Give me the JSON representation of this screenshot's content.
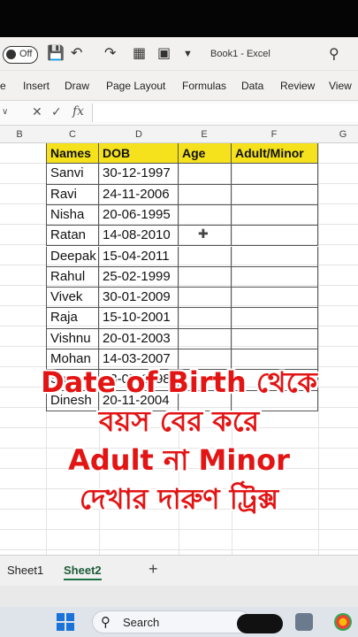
{
  "titlebar": {
    "autosave_label": "Off",
    "doc_title": "Book1  -  Excel"
  },
  "ribbon": {
    "tabs": [
      "e",
      "Insert",
      "Draw",
      "Page Layout",
      "Formulas",
      "Data",
      "Review",
      "View"
    ]
  },
  "formula": {
    "fx_label": "fx"
  },
  "columns": [
    "B",
    "C",
    "D",
    "E",
    "F",
    "G"
  ],
  "table": {
    "headers": [
      "Names",
      "DOB",
      "Age",
      "Adult/Minor"
    ],
    "rows": [
      [
        "Sanvi",
        "30-12-1997"
      ],
      [
        "Ravi",
        "24-11-2006"
      ],
      [
        "Nisha",
        "20-06-1995"
      ],
      [
        "Ratan",
        "14-08-2010"
      ],
      [
        "Deepak",
        "15-04-2011"
      ],
      [
        "Rahul",
        "25-02-1999"
      ],
      [
        "Vivek",
        "30-01-2009"
      ],
      [
        "Raja",
        "15-10-2001"
      ],
      [
        "Vishnu",
        "20-01-2003"
      ],
      [
        "Mohan",
        "14-03-2007"
      ],
      [
        "Sonu",
        "13-07-1998"
      ],
      [
        "Dinesh",
        "20-11-2004"
      ]
    ]
  },
  "overlay": {
    "line1": "Date of Birth থেকে",
    "line2": "বয়স বের করে",
    "line3": "Adult না Minor",
    "line4": "দেখার দারুণ ট্রিক্স"
  },
  "sheets": [
    "Sheet1",
    "Sheet2"
  ],
  "add_sheet": "+",
  "taskbar": {
    "search_label": "Search"
  },
  "colors": {
    "header_fill": "#f5e21c",
    "overlay_text": "#e31414"
  }
}
